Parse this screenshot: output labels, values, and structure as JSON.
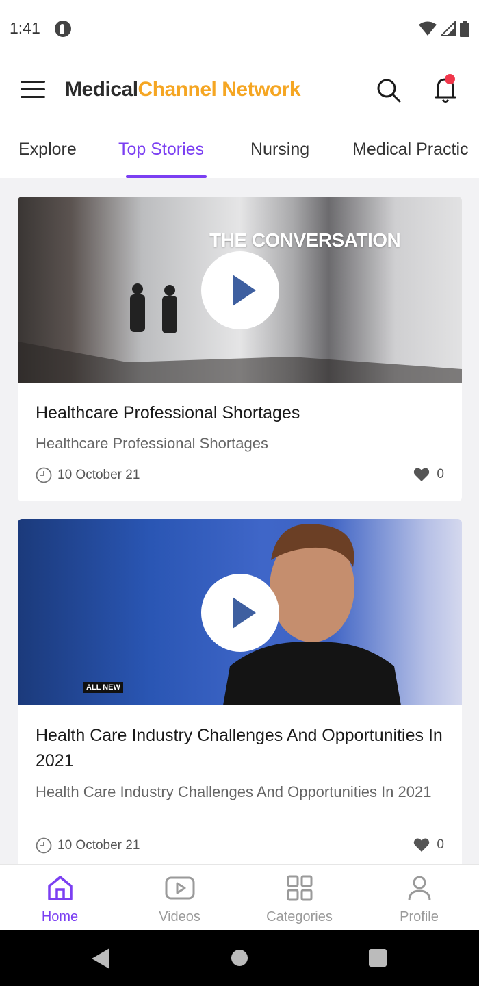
{
  "status_bar": {
    "time": "1:41"
  },
  "app_bar": {
    "brand_part1": "Medical",
    "brand_part2": "Channel Network"
  },
  "tabs": [
    {
      "label": "Explore",
      "active": false
    },
    {
      "label": "Top Stories",
      "active": true
    },
    {
      "label": "Nursing",
      "active": false
    },
    {
      "label": "Medical Practic",
      "active": false
    }
  ],
  "cards": [
    {
      "thumb_overlay": "THE CONVERSATION",
      "title": "Healthcare Professional Shortages",
      "subtitle": "Healthcare Professional Shortages",
      "date": "10 October 21",
      "likes": "0"
    },
    {
      "thumb_overlay": "ALL NEW",
      "title": "Health Care Industry Challenges And Opportunities In 2021",
      "subtitle": "Health Care Industry Challenges And Opportunities In 2021",
      "date": "10 October 21",
      "likes": "0"
    }
  ],
  "bottom_nav": [
    {
      "label": "Home",
      "icon": "home-icon",
      "active": true
    },
    {
      "label": "Videos",
      "icon": "video-icon",
      "active": false
    },
    {
      "label": "Categories",
      "icon": "grid-icon",
      "active": false
    },
    {
      "label": "Profile",
      "icon": "person-icon",
      "active": false
    }
  ],
  "colors": {
    "accent": "#7b3ff2",
    "brand_orange": "#f5a623",
    "notification": "#f0364a"
  }
}
